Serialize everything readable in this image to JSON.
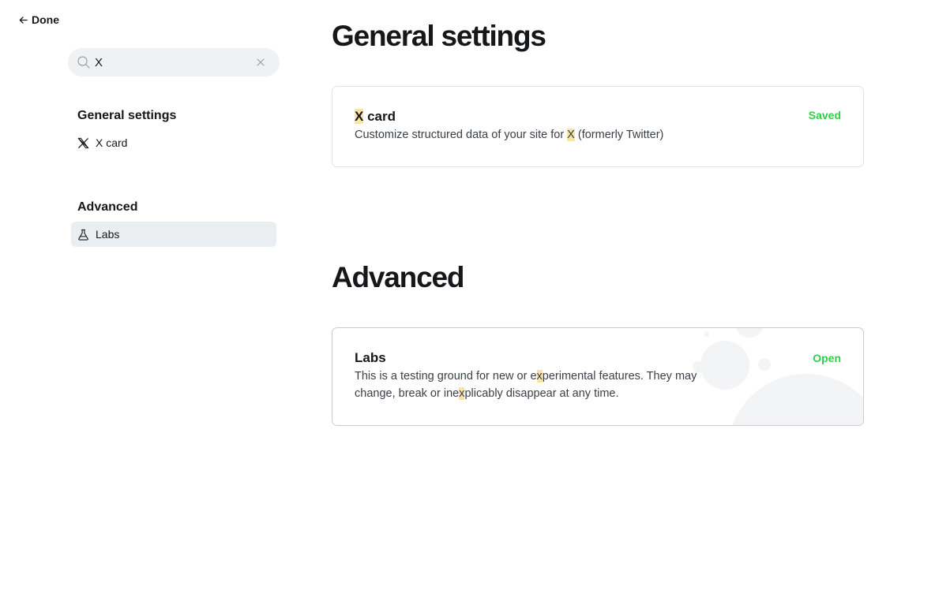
{
  "nav": {
    "done_label": "Done"
  },
  "search": {
    "value": "X",
    "placeholder": ""
  },
  "sidebar": {
    "sections": [
      {
        "heading": "General settings",
        "items": [
          {
            "label": "X card",
            "icon": "x-logo-icon"
          }
        ]
      },
      {
        "heading": "Advanced",
        "items": [
          {
            "label": "Labs",
            "icon": "flask-icon",
            "active": true
          }
        ]
      }
    ]
  },
  "main": {
    "general": {
      "title": "General settings",
      "card": {
        "title_highlight": "X",
        "title_rest": " card",
        "desc_before": "Customize structured data of your site for ",
        "desc_highlight": "X",
        "desc_after": " (formerly Twitter)",
        "action": "Saved"
      }
    },
    "advanced": {
      "title": "Advanced",
      "card": {
        "title": "Labs",
        "line1_before": "This is a testing ground for new or e",
        "line1_highlight": "x",
        "line1_after": "perimental features. They may",
        "line2_before": "change, break or ine",
        "line2_highlight": "x",
        "line2_after": "plicably disappear at any time.",
        "action": "Open"
      }
    }
  },
  "colors": {
    "accent_green": "#30cf43",
    "highlight": "#fbe3a6",
    "active_bg": "#ebeef0"
  }
}
